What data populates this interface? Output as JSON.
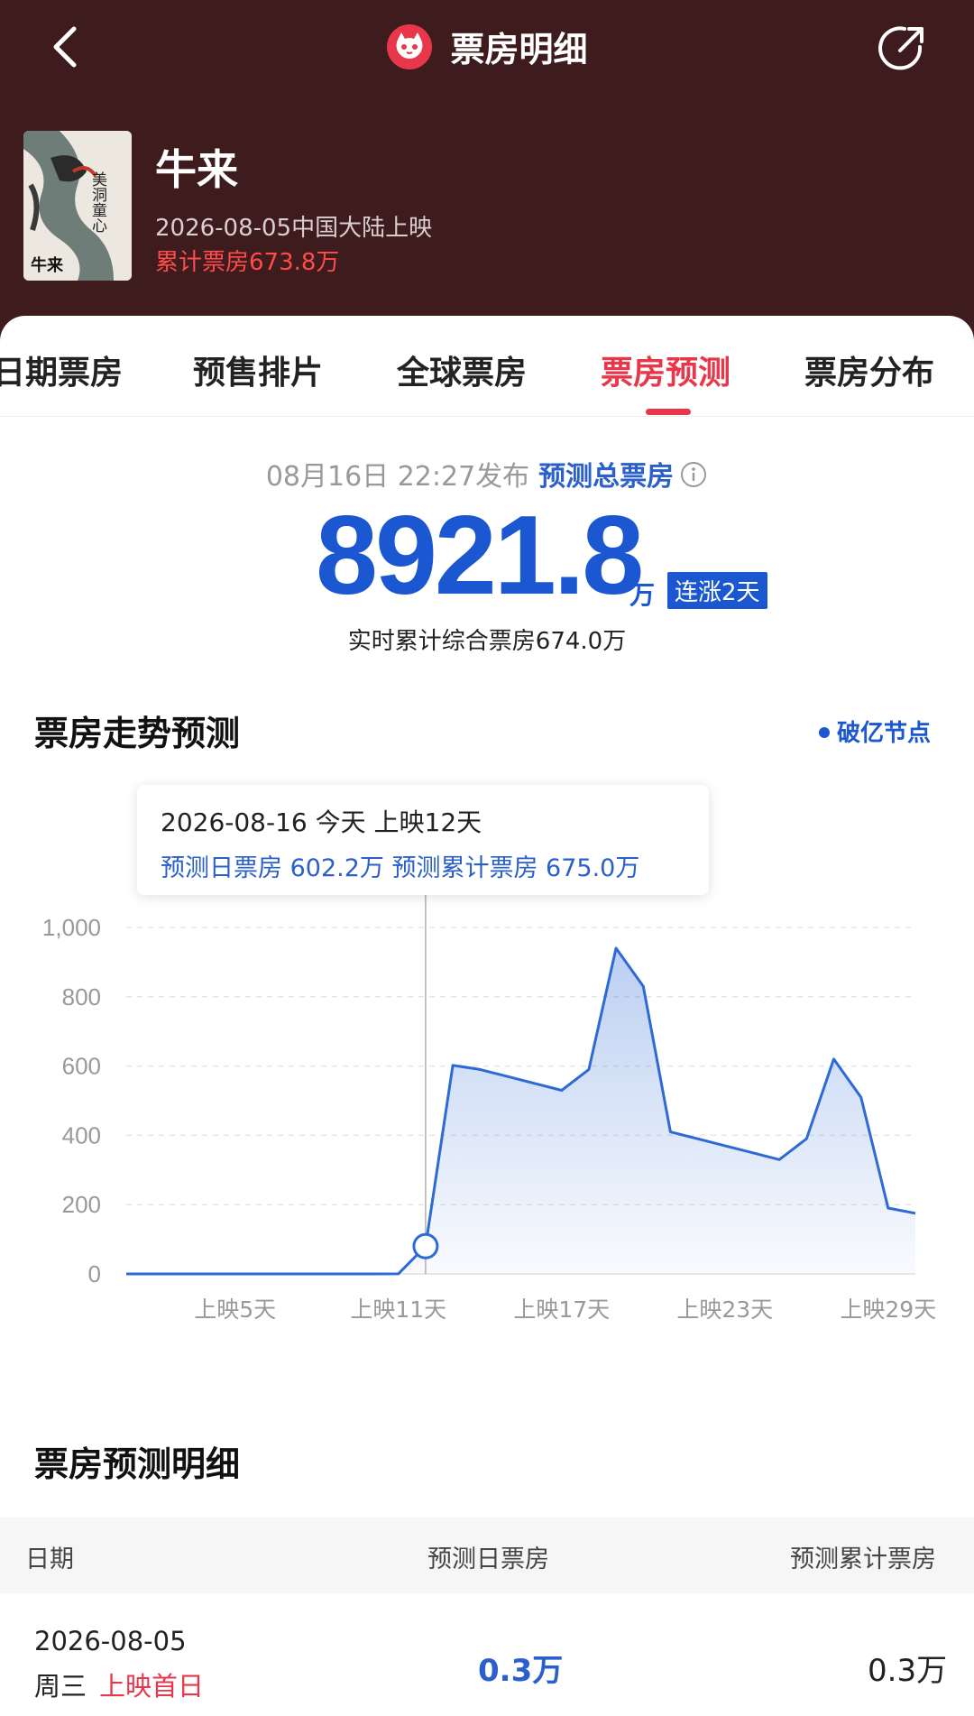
{
  "header": {
    "title": "票房明细",
    "movie": {
      "title": "牛来",
      "release": "2026-08-05中国大陆上映",
      "cumulative": "累计票房673.8万",
      "poster_texts": [
        "美洞童心",
        "牛来"
      ]
    }
  },
  "tabs": [
    "日期票房",
    "预售排片",
    "全球票房",
    "票房预测",
    "票房分布"
  ],
  "active_tab": 3,
  "summary": {
    "publish_time": "08月16日 22:27发布",
    "label": "预测总票房",
    "value": "8921.8",
    "unit": "万",
    "streak": "连涨2天",
    "realtime": "实时累计综合票房674.0万"
  },
  "trend": {
    "title": "票房走势预测",
    "legend": "破亿节点",
    "tooltip": {
      "line1": "2026-08-16 今天    上映12天",
      "line2": "预测日票房 602.2万    预测累计票房 675.0万"
    }
  },
  "chart_data": {
    "type": "area",
    "x": [
      1,
      2,
      3,
      4,
      5,
      6,
      7,
      8,
      9,
      10,
      11,
      12,
      13,
      14,
      15,
      16,
      17,
      18,
      19,
      20,
      21,
      22,
      23,
      24,
      25,
      26,
      27,
      28,
      29,
      30
    ],
    "x_tick_labels": [
      "上映5天",
      "上映11天",
      "上映17天",
      "上映23天",
      "上映29天"
    ],
    "x_ticks": [
      5,
      11,
      17,
      23,
      29
    ],
    "y_tick_labels": [
      "0",
      "200",
      "400",
      "600",
      "800",
      "1,000"
    ],
    "ylim": [
      0,
      1000
    ],
    "values": [
      0,
      0,
      0,
      0,
      0,
      0,
      0,
      0,
      0,
      0,
      0.3,
      80,
      602.2,
      590,
      570,
      550,
      530,
      590,
      940,
      830,
      410,
      390,
      370,
      350,
      330,
      390,
      620,
      510,
      190,
      175
    ],
    "highlight_x": 12,
    "color": "#2d6ad6",
    "grid": true
  },
  "detail": {
    "title": "票房预测明细",
    "headers": [
      "日期",
      "预测日票房",
      "预测累计票房"
    ],
    "rows": [
      {
        "date": "2026-08-05",
        "weekday": "周三",
        "tag": "上映首日",
        "daily": "0.3万",
        "cumulative": "0.3万"
      }
    ]
  }
}
